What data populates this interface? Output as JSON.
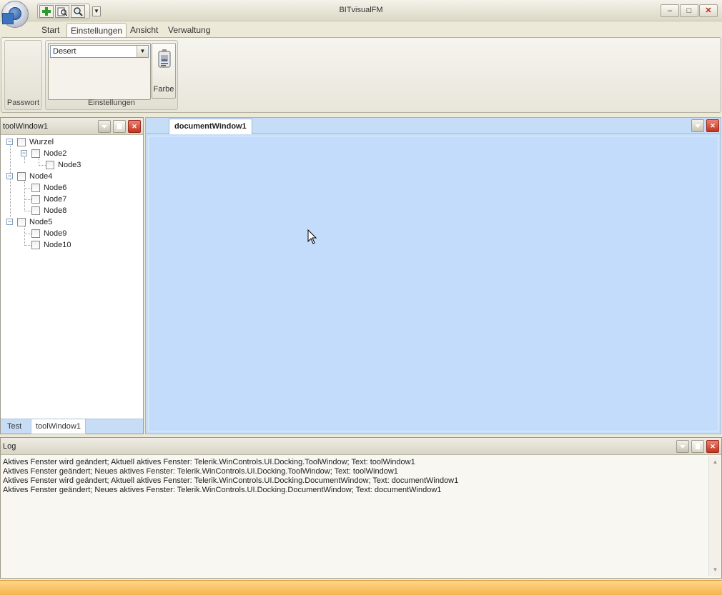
{
  "window": {
    "title": "BITvisualFM",
    "minimize": "–",
    "maximize": "□",
    "close": "✕"
  },
  "quick_access": [
    "add-icon",
    "print-preview-icon",
    "search-icon"
  ],
  "ribbon": {
    "tabs": [
      "Start",
      "Einstellungen",
      "Ansicht",
      "Verwaltung"
    ],
    "active_tab": "Einstellungen",
    "groups": {
      "passwort": {
        "label": "Passwort"
      },
      "einstellungen": {
        "label": "Einstellungen",
        "theme_value": "Desert",
        "farbe_label": "Farbe"
      }
    }
  },
  "tool_window": {
    "title": "toolWindow1",
    "tree": [
      {
        "label": "Wurzel",
        "expanded": true
      },
      {
        "label": "Node2",
        "expanded": true
      },
      {
        "label": "Node3"
      },
      {
        "label": "Node4",
        "expanded": true
      },
      {
        "label": "Node6"
      },
      {
        "label": "Node7"
      },
      {
        "label": "Node8"
      },
      {
        "label": "Node5",
        "expanded": true
      },
      {
        "label": "Node9"
      },
      {
        "label": "Node10"
      }
    ],
    "bottom_tabs": [
      "Test",
      "toolWindow1"
    ]
  },
  "document_window": {
    "tab": "documentWindow1"
  },
  "log": {
    "title": "Log",
    "lines": [
      "Aktives Fenster wird geändert; Aktuell aktives Fenster: Telerik.WinControls.UI.Docking.ToolWindow; Text: toolWindow1",
      "Aktives Fenster geändert; Neues aktives Fenster: Telerik.WinControls.UI.Docking.ToolWindow; Text: toolWindow1",
      "Aktives Fenster wird geändert; Aktuell aktives Fenster: Telerik.WinControls.UI.Docking.DocumentWindow; Text: documentWindow1",
      "Aktives Fenster geändert; Neues aktives Fenster: Telerik.WinControls.UI.Docking.DocumentWindow; Text: documentWindow1"
    ]
  },
  "colors": {
    "document_background": "#c3dcfb",
    "status_bar": "#f6b44c",
    "close_button": "#c43320"
  }
}
